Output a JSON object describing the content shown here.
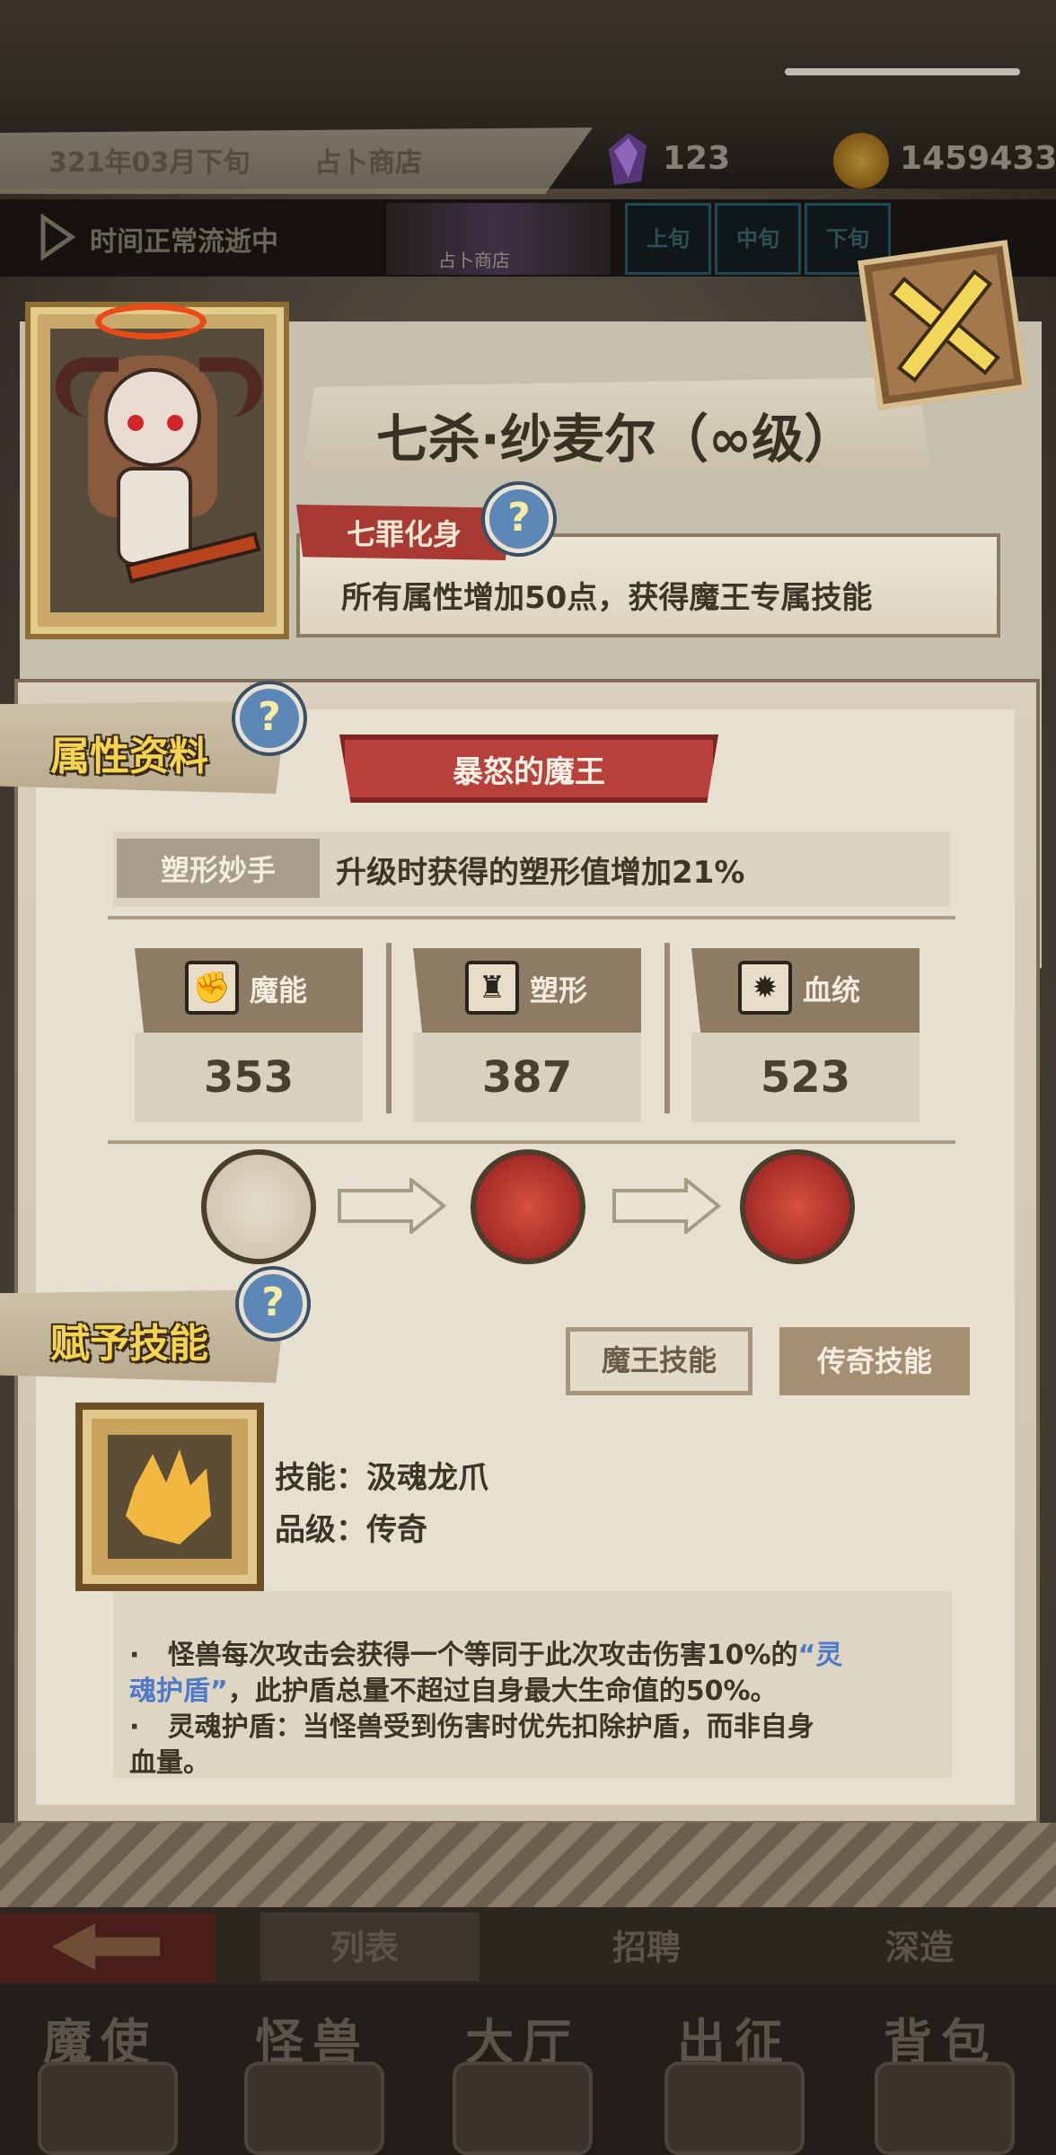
{
  "header": {
    "date": "321年03月下旬",
    "location": "占卜商店",
    "crystal_count": "123",
    "coin_count": "1459433",
    "time_status": "时间正常流逝中",
    "shop_thumb_label": "占卜商店",
    "periods": [
      "上旬",
      "中旬",
      "下旬"
    ]
  },
  "character": {
    "name": "七杀·纱麦尔（∞级）",
    "sin_tag": "七罪化身",
    "sin_desc": "所有属性增加50点，获得魔王专属技能",
    "help_glyph": "?"
  },
  "attributes": {
    "section_title": "属性资料",
    "demon_title": "暴怒的魔王",
    "trait_tag": "塑形妙手",
    "trait_desc": "升级时获得的塑形值增加21%",
    "stats": [
      {
        "label": "魔能",
        "value": "353",
        "icon": "magic-fist-icon"
      },
      {
        "label": "塑形",
        "value": "387",
        "icon": "muscle-body-icon"
      },
      {
        "label": "血统",
        "value": "523",
        "icon": "bloodline-burst-icon"
      }
    ],
    "evolution": [
      "hooded-figure-icon",
      "red-demon-face-icon",
      "red-demon-face-icon"
    ]
  },
  "skills": {
    "section_title": "赋予技能",
    "toggle_demon": "魔王技能",
    "toggle_legend": "传奇技能",
    "skill_name": "技能：汲魂龙爪",
    "skill_grade": "品级：传奇",
    "desc": {
      "bullet": "·",
      "l1a": "怪兽每次攻击会获得一个等同于此次攻击伤害10%的",
      "l1b": "“灵",
      "l2a": "魂护盾”",
      "l2b": "，此护盾总量不超过自身最大生命值的50%。",
      "l3": "灵魂护盾：当怪兽受到伤害时优先扣除护盾，而非自身",
      "l4": "血量。"
    },
    "highlight_color": "#4f79c9"
  },
  "subnav": {
    "items": [
      "列表",
      "招聘",
      "深造"
    ]
  },
  "mainnav": {
    "items": [
      "魔使",
      "怪兽",
      "大厅",
      "出征",
      "背包"
    ]
  }
}
